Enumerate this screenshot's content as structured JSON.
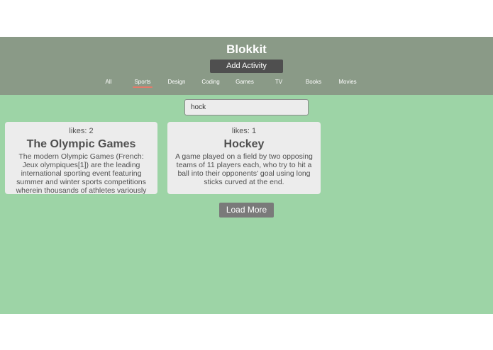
{
  "header": {
    "title": "Blokkit",
    "add_label": "Add Activity"
  },
  "nav": {
    "tabs": [
      {
        "label": "All",
        "active": false
      },
      {
        "label": "Sports",
        "active": true
      },
      {
        "label": "Design",
        "active": false
      },
      {
        "label": "Coding",
        "active": false
      },
      {
        "label": "Games",
        "active": false
      },
      {
        "label": "TV",
        "active": false
      },
      {
        "label": "Books",
        "active": false
      },
      {
        "label": "Movies",
        "active": false
      }
    ]
  },
  "search": {
    "value": "hock"
  },
  "cards": [
    {
      "likes": "likes: 2",
      "title": "The Olympic Games",
      "body": "The modern Olympic Games (French: Jeux olympiques[1]) are the leading international sporting event featuring summer and winter sports competitions wherein thousands of athletes variously compete. The Olympic"
    },
    {
      "likes": "likes: 1",
      "title": "Hockey",
      "body": "A game played on a field by two opposing teams of 11 players each, who try to hit a ball into their opponents' goal using long sticks curved at the end."
    }
  ],
  "load_more_label": "Load More",
  "colors": {
    "header_bg": "#8a9a87",
    "page_bg": "#9dd4a6",
    "card_bg": "#ececec",
    "active_tab_underline": "#e57a6a"
  }
}
